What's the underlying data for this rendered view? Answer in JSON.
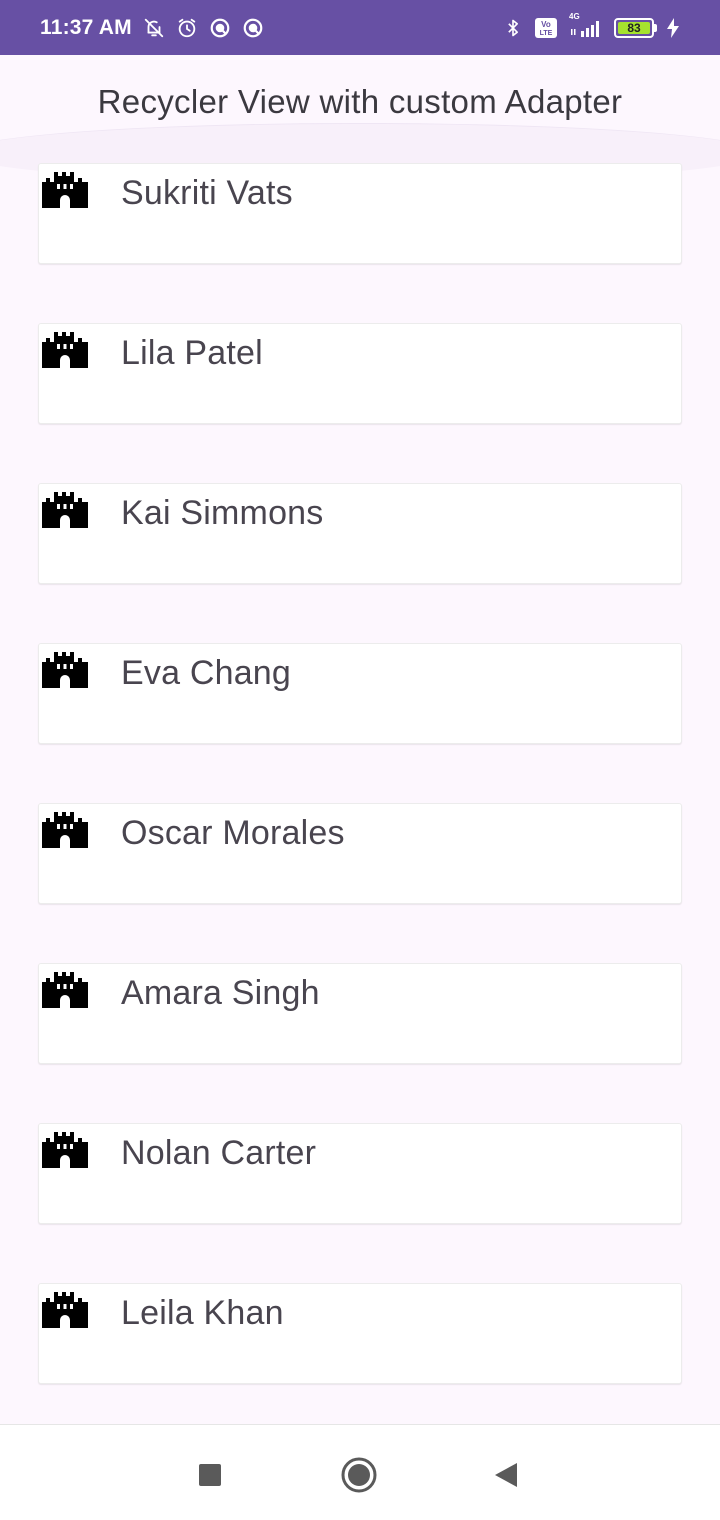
{
  "status_bar": {
    "time": "11:37 AM",
    "left_icons": [
      "bell-off-icon",
      "alarm-icon",
      "app-notification-icon",
      "app-notification-icon"
    ],
    "right_icons": [
      "bluetooth-icon",
      "volte-icon",
      "signal-4g-icon"
    ],
    "network_label": "4G",
    "battery_level": "83",
    "background_color": "#6750a4"
  },
  "app_bar": {
    "title": "Recycler View with custom Adapter"
  },
  "list": {
    "item_icon": "castle-icon",
    "items": [
      {
        "name": "Sukriti Vats"
      },
      {
        "name": "Lila Patel"
      },
      {
        "name": "Kai Simmons"
      },
      {
        "name": "Eva Chang"
      },
      {
        "name": "Oscar Morales"
      },
      {
        "name": "Amara Singh"
      },
      {
        "name": "Nolan Carter"
      },
      {
        "name": "Leila Khan"
      }
    ]
  },
  "nav_bar": {
    "buttons": [
      "recents-square-icon",
      "home-circle-icon",
      "back-triangle-icon"
    ]
  }
}
